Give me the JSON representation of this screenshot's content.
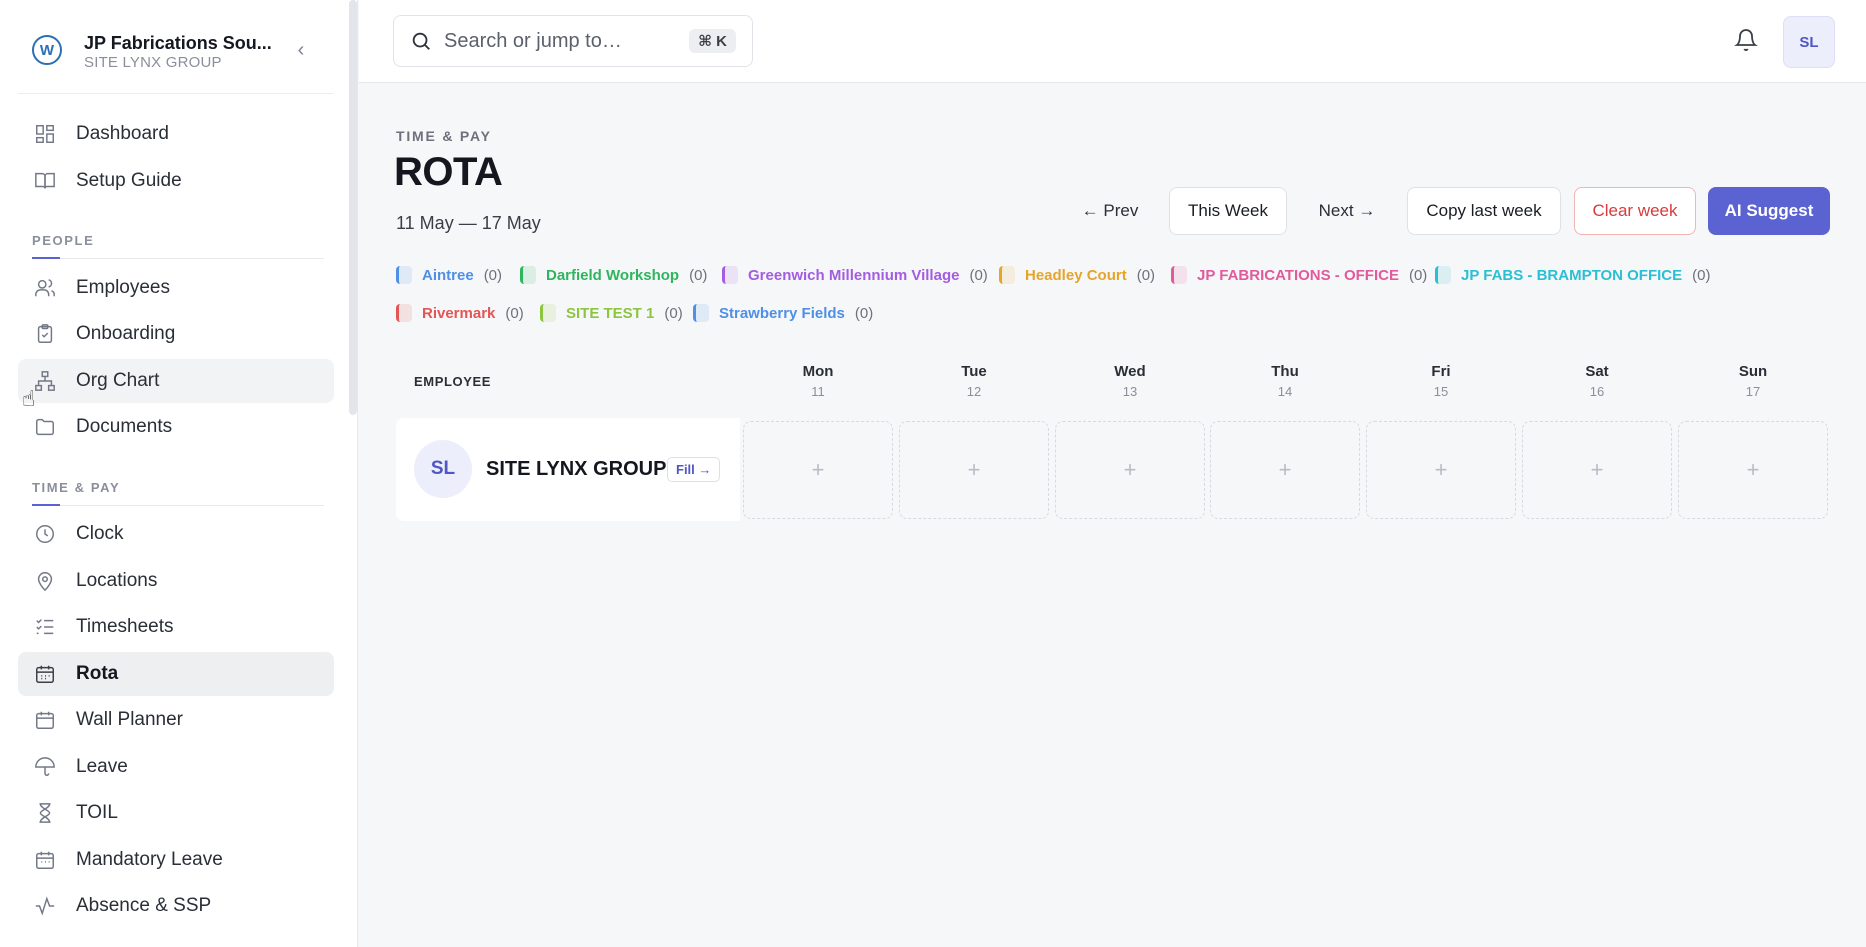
{
  "org": {
    "name": "JP Fabrications Sou...",
    "sub": "SITE LYNX GROUP",
    "logo": "W"
  },
  "nav": {
    "top": [
      {
        "label": "Dashboard",
        "icon": "dashboard-icon"
      },
      {
        "label": "Setup Guide",
        "icon": "book-icon"
      }
    ],
    "people_label": "PEOPLE",
    "people": [
      {
        "label": "Employees",
        "icon": "users-icon"
      },
      {
        "label": "Onboarding",
        "icon": "clipboard-icon"
      },
      {
        "label": "Org Chart",
        "icon": "org-chart-icon"
      },
      {
        "label": "Documents",
        "icon": "folder-icon"
      }
    ],
    "timepay_label": "TIME & PAY",
    "timepay": [
      {
        "label": "Clock",
        "icon": "clock-icon"
      },
      {
        "label": "Locations",
        "icon": "map-pin-icon"
      },
      {
        "label": "Timesheets",
        "icon": "checklist-icon"
      },
      {
        "label": "Rota",
        "icon": "calendar-icon"
      },
      {
        "label": "Wall Planner",
        "icon": "calendar-icon"
      },
      {
        "label": "Leave",
        "icon": "umbrella-icon"
      },
      {
        "label": "TOIL",
        "icon": "hourglass-icon"
      },
      {
        "label": "Mandatory Leave",
        "icon": "calendar-icon"
      },
      {
        "label": "Absence & SSP",
        "icon": "activity-icon"
      }
    ]
  },
  "topbar": {
    "search_placeholder": "Search or jump to…",
    "shortcut": "⌘ K",
    "avatar": "SL"
  },
  "page": {
    "eyebrow": "TIME & PAY",
    "title": "ROTA",
    "date_range": "11 May — 17 May"
  },
  "actions": {
    "prev": "← Prev",
    "this_week": "This Week",
    "next": "Next →",
    "copy": "Copy last week",
    "clear": "Clear week",
    "ai": "AI Suggest"
  },
  "locations": [
    {
      "name": "Aintree",
      "count": "(0)",
      "color": "#4f8fe6"
    },
    {
      "name": "Darfield Workshop",
      "count": "(0)",
      "color": "#2fb55e"
    },
    {
      "name": "Greenwich Millennium Village",
      "count": "(0)",
      "color": "#a35de0"
    },
    {
      "name": "Headley Court",
      "count": "(0)",
      "color": "#e5a52a"
    },
    {
      "name": "JP FABRICATIONS - OFFICE",
      "count": "(0)",
      "color": "#e15a9c"
    },
    {
      "name": "JP FABS - BRAMPTON OFFICE",
      "count": "(0)",
      "color": "#2bbfd4"
    },
    {
      "name": "Rivermark",
      "count": "(0)",
      "color": "#e45555"
    },
    {
      "name": "SITE TEST 1",
      "count": "(0)",
      "color": "#8cc63f"
    },
    {
      "name": "Strawberry Fields",
      "count": "(0)",
      "color": "#4f8fe6"
    }
  ],
  "grid": {
    "employee_header": "EMPLOYEE",
    "days": [
      {
        "name": "Mon",
        "date": "11"
      },
      {
        "name": "Tue",
        "date": "12"
      },
      {
        "name": "Wed",
        "date": "13"
      },
      {
        "name": "Thu",
        "date": "14"
      },
      {
        "name": "Fri",
        "date": "15"
      },
      {
        "name": "Sat",
        "date": "16"
      },
      {
        "name": "Sun",
        "date": "17"
      }
    ],
    "employee": {
      "initials": "SL",
      "name": "SITE LYNX GROUP",
      "fill": "Fill →"
    },
    "add": "+"
  }
}
